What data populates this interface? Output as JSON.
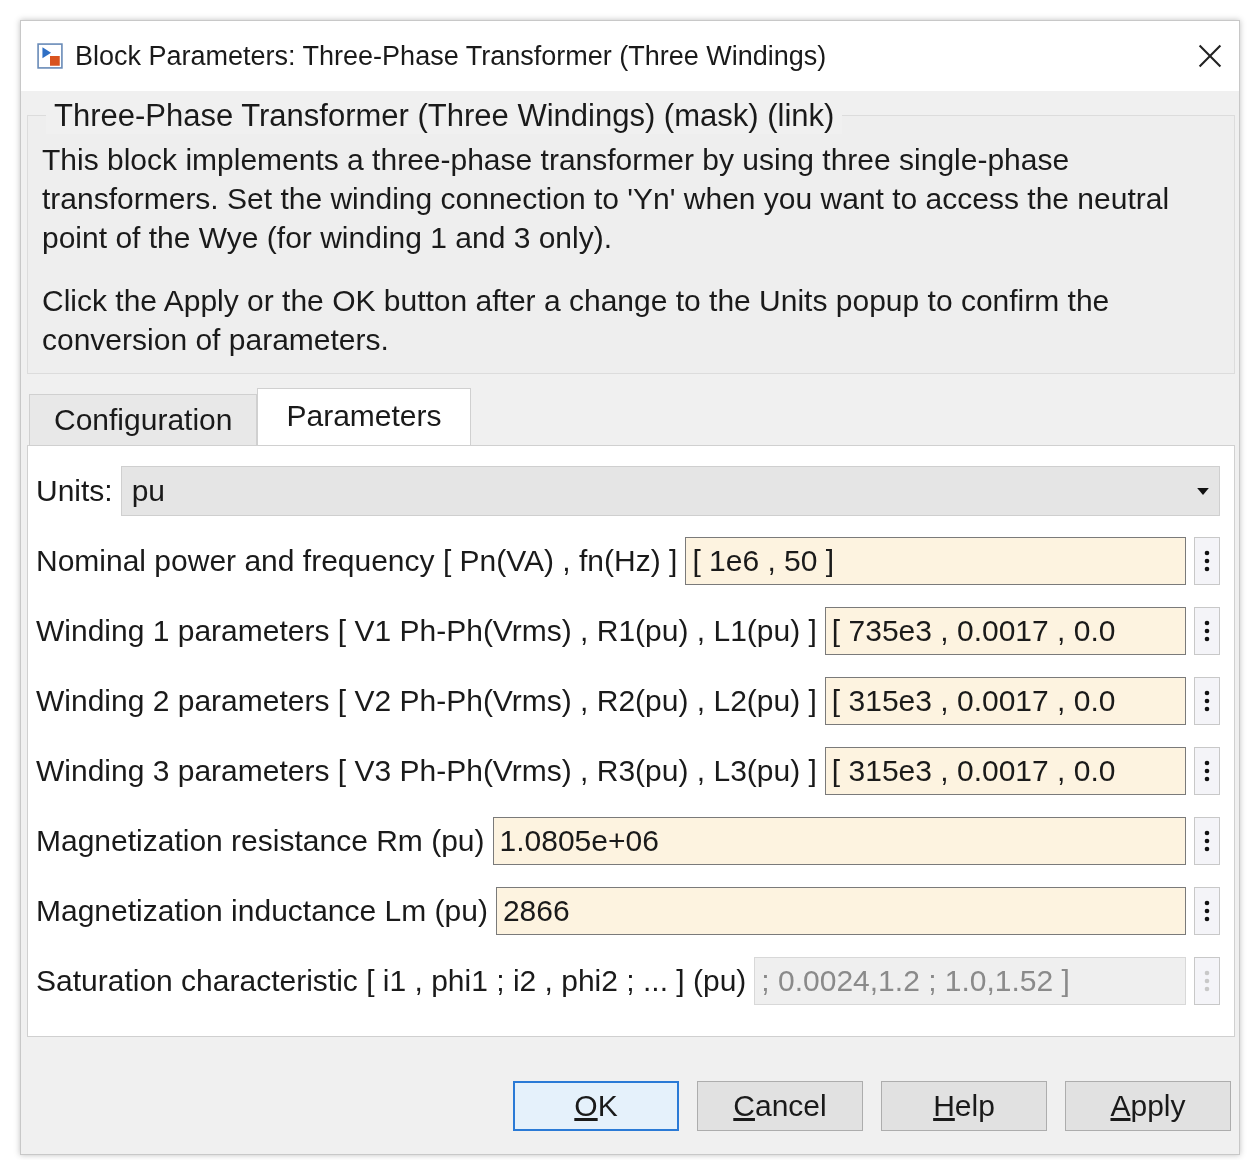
{
  "window": {
    "title": "Block Parameters: Three-Phase Transformer (Three Windings)"
  },
  "group": {
    "title": "Three-Phase Transformer (Three Windings) (mask) (link)",
    "paragraphs": [
      "This block implements a three-phase transformer by using three single-phase transformers. Set the winding connection to 'Yn' when you want to access the neutral point of the Wye (for winding 1 and 3 only).",
      "Click the Apply or the OK button after a change to the Units popup to confirm the conversion of parameters."
    ]
  },
  "tabs": [
    {
      "label": "Configuration",
      "selected": false
    },
    {
      "label": "Parameters",
      "selected": true
    }
  ],
  "units": {
    "label": "Units:",
    "value": "pu"
  },
  "parameters": [
    {
      "label": "Nominal power and frequency  [ Pn(VA) , fn(Hz) ]",
      "value": "[ 1e6 , 50 ]",
      "disabled": false
    },
    {
      "label": "Winding 1 parameters [ V1 Ph-Ph(Vrms) , R1(pu) , L1(pu) ]",
      "value": "[ 735e3 , 0.0017 , 0.0",
      "disabled": false
    },
    {
      "label": "Winding 2 parameters [ V2 Ph-Ph(Vrms) , R2(pu) , L2(pu) ]",
      "value": "[ 315e3 , 0.0017 , 0.0",
      "disabled": false
    },
    {
      "label": "Winding 3 parameters [ V3 Ph-Ph(Vrms) , R3(pu) , L3(pu) ]",
      "value": "[ 315e3 , 0.0017 , 0.0",
      "disabled": false
    },
    {
      "label": "Magnetization resistance  Rm (pu)",
      "value": "1.0805e+06",
      "disabled": false
    },
    {
      "label": "Magnetization inductance  Lm (pu)",
      "value": "2866",
      "disabled": false
    },
    {
      "label": "Saturation characteristic [ i1 ,  phi1 ;  i2 , phi2 ; ... ] (pu)",
      "value": "; 0.0024,1.2 ; 1.0,1.52 ]",
      "disabled": true
    }
  ],
  "buttons": [
    {
      "label": "OK",
      "selected": true
    },
    {
      "label": "Cancel",
      "selected": false
    },
    {
      "label": "Help",
      "selected": false
    },
    {
      "label": "Apply",
      "selected": false
    }
  ]
}
